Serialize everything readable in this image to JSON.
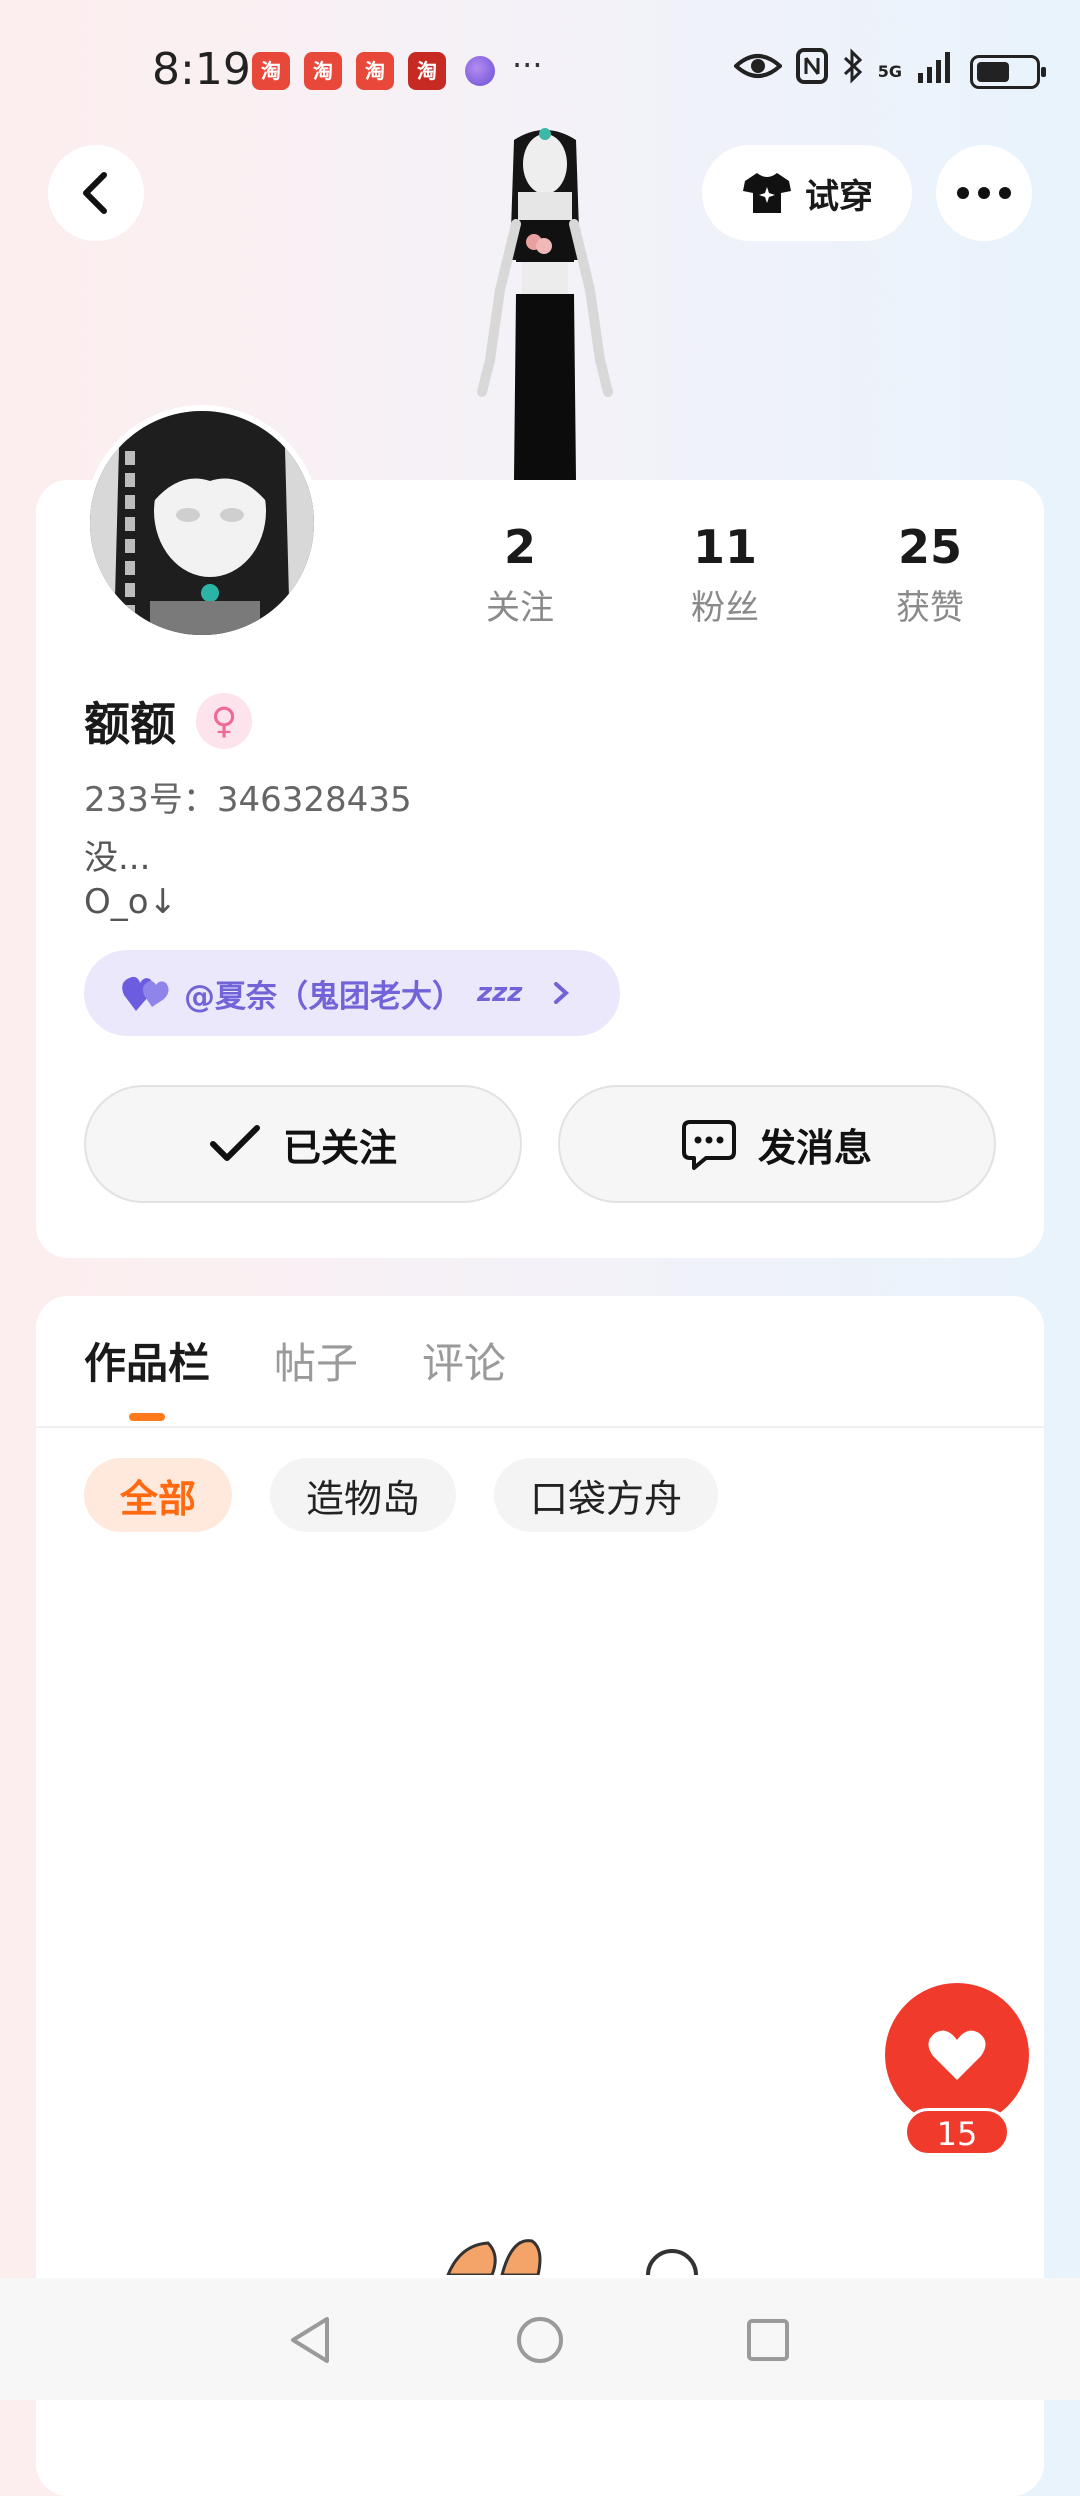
{
  "status_bar": {
    "time": "8:19",
    "notification_icons": [
      "taobao-icon",
      "taobao-icon",
      "taobao-icon",
      "taobao-icon",
      "app-orb-icon"
    ],
    "notification_glyph": "淘",
    "more_indicator": "···",
    "signal_label": "5G"
  },
  "header": {
    "try_on_label": "试穿"
  },
  "profile": {
    "stats": [
      {
        "value": "2",
        "label": "关注"
      },
      {
        "value": "11",
        "label": "粉丝"
      },
      {
        "value": "25",
        "label": "获赞"
      }
    ],
    "name": "额额",
    "gender_symbol": "♀",
    "uid": "233号：346328435",
    "bio_line1": "没...",
    "bio_line2": "O_o↓",
    "relation_label": "@夏奈（鬼团老大）",
    "relation_suffix": "zzz",
    "follow_button": "已关注",
    "message_button": "发消息"
  },
  "works": {
    "tabs": [
      {
        "label": "作品栏",
        "active": true
      },
      {
        "label": "帖子",
        "active": false
      },
      {
        "label": "评论",
        "active": false
      }
    ],
    "filters": [
      {
        "label": "全部",
        "active": true
      },
      {
        "label": "造物岛",
        "active": false
      },
      {
        "label": "口袋方舟",
        "active": false
      }
    ]
  },
  "like_button": {
    "count": "15"
  },
  "colors": {
    "accent": "#ff7a1a",
    "like_red": "#f03a2c",
    "relation_purple": "#7263d8"
  }
}
